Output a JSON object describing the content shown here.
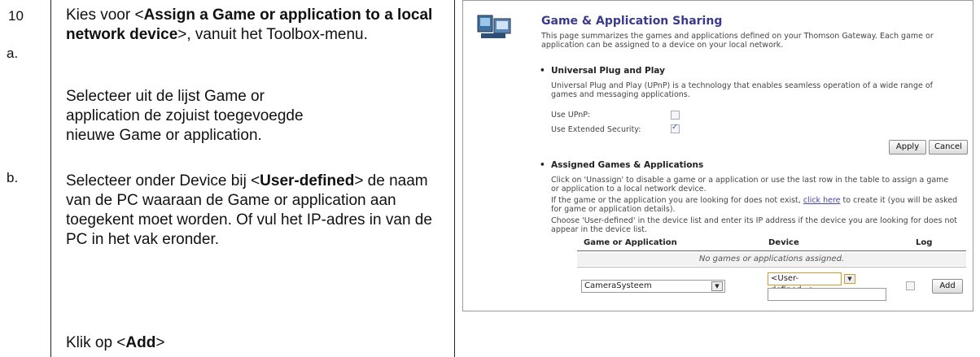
{
  "doc": {
    "step_number_top": "10",
    "step_letter_a": "a.",
    "step_letter_b": "b.",
    "para1_prefix": "Kies voor <",
    "para1_bold": "Assign a Game or application to a local network device",
    "para1_suffix": ">, vanuit het Toolbox-menu.",
    "para2": "Selecteer uit de lijst Game or application de zojuist toegevoegde nieuwe Game or application.",
    "para3_prefix": "Selecteer onder Device bij <",
    "para3_bold": "User-defined",
    "para3_suffix": "> de naam van de PC waaraan de Game or application aan toegekent moet worden. Of vul het IP-adres in van de PC in het vak eronder.",
    "para4_prefix": "Klik op <",
    "para4_bold": "Add",
    "para4_suffix": ">"
  },
  "screenshot": {
    "title": "Game & Application Sharing",
    "intro": "This page summarizes the games and applications defined on your Thomson Gateway. Each game or application can be assigned to a device on your local network.",
    "upnp_heading": "Universal Plug and Play",
    "upnp_desc": "Universal Plug and Play (UPnP) is a technology that enables seamless operation of a wide range of games and messaging applications.",
    "use_upnp_label": "Use UPnP:",
    "use_upnp_checked": false,
    "ext_security_label": "Use Extended Security:",
    "ext_security_checked": true,
    "apply_label": "Apply",
    "cancel_label": "Cancel",
    "assigned_heading": "Assigned Games & Applications",
    "assigned_desc": "Click on 'Unassign' to disable a game or a application or use the last row in the table to assign a game or application to a local network device.",
    "missing_prefix": "If the game or the application you are looking for does not exist, ",
    "missing_link": "click here",
    "missing_suffix": " to create it (you will be asked for game or application details).",
    "user_defined_desc": "Choose 'User-defined' in the device list and enter its IP address if the device you are looking for does not appear in the device list.",
    "col_game": "Game or Application",
    "col_device": "Device",
    "col_log": "Log",
    "empty_row": "No games or applications assigned.",
    "game_select_value": "CameraSysteem",
    "device_select_value": "<User-defined...>",
    "add_label": "Add"
  }
}
